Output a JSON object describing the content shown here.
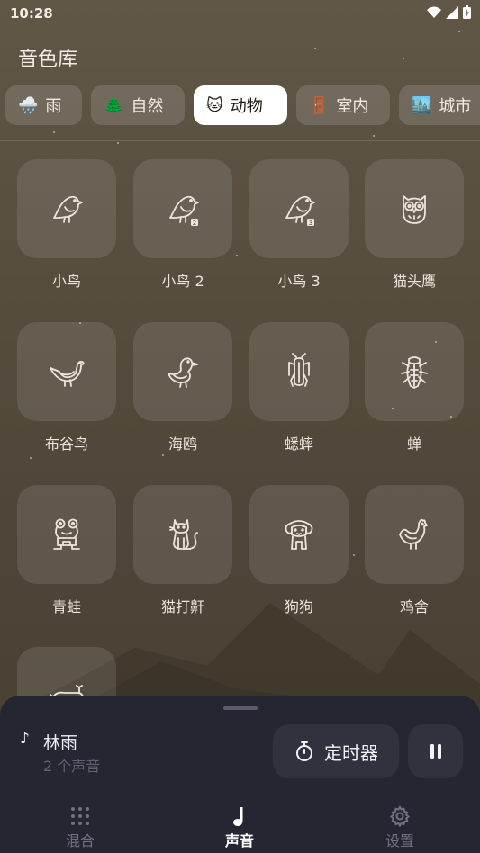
{
  "status_bar": {
    "time": "10:28"
  },
  "header": {
    "title": "音色库"
  },
  "tabs": [
    {
      "emoji": "🌧️",
      "label": "雨",
      "active": false
    },
    {
      "emoji": "🌲",
      "label": "自然",
      "active": false
    },
    {
      "emoji": "🐱",
      "label": "动物",
      "active": true
    },
    {
      "emoji": "🚪",
      "label": "室内",
      "active": false
    },
    {
      "emoji": "🏙️",
      "label": "城市",
      "active": false
    }
  ],
  "sounds": [
    {
      "label": "小鸟",
      "icon": "bird-icon"
    },
    {
      "label": "小鸟 2",
      "icon": "bird-2-icon"
    },
    {
      "label": "小鸟 3",
      "icon": "bird-3-icon"
    },
    {
      "label": "猫头鹰",
      "icon": "owl-icon"
    },
    {
      "label": "布谷鸟",
      "icon": "cuckoo-icon"
    },
    {
      "label": "海鸥",
      "icon": "seagull-icon"
    },
    {
      "label": "蟋蟀",
      "icon": "cricket-icon"
    },
    {
      "label": "蝉",
      "icon": "cicada-icon"
    },
    {
      "label": "青蛙",
      "icon": "frog-icon"
    },
    {
      "label": "猫打鼾",
      "icon": "cat-purring-icon"
    },
    {
      "label": "狗狗",
      "icon": "dog-icon"
    },
    {
      "label": "鸡舍",
      "icon": "chicken-icon"
    },
    {
      "label": "",
      "icon": "whale-icon"
    }
  ],
  "player": {
    "mix_name": "林雨",
    "mix_detail": "2 个声音",
    "timer_label": "定时器",
    "note_symbol": "♪"
  },
  "bottom_nav": [
    {
      "label": "混合",
      "icon": "grid-dots-icon",
      "active": false
    },
    {
      "label": "声音",
      "icon": "music-note-icon",
      "active": true
    },
    {
      "label": "设置",
      "icon": "gear-icon",
      "active": false
    }
  ],
  "colors": {
    "accent_active_tab": "#ffffff",
    "sheet_bg": "#242631",
    "bg_top": "#605747",
    "bg_bottom": "#463e31"
  }
}
